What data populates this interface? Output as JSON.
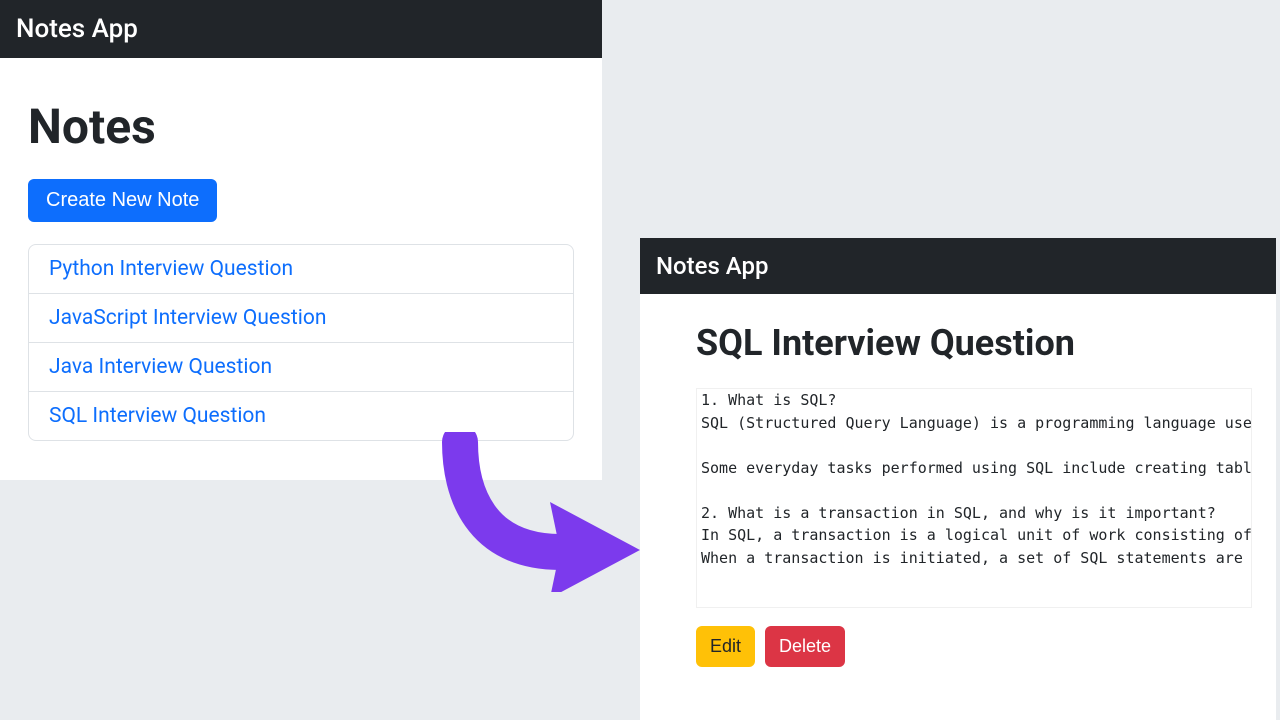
{
  "left": {
    "brand": "Notes App",
    "title": "Notes",
    "create_label": "Create New Note",
    "items": [
      "Python Interview Question",
      "JavaScript Interview Question",
      "Java Interview Question",
      "SQL Interview Question"
    ]
  },
  "right": {
    "brand": "Notes App",
    "title": "SQL Interview Question",
    "body": "1. What is SQL?\nSQL (Structured Query Language) is a programming language used t\n\nSome everyday tasks performed using SQL include creating tables\n\n2. What is a transaction in SQL, and why is it important?\nIn SQL, a transaction is a logical unit of work consisting of on\nWhen a transaction is initiated, a set of SQL statements are exe",
    "edit_label": "Edit",
    "delete_label": "Delete"
  },
  "colors": {
    "arrow": "#7c3aed"
  }
}
